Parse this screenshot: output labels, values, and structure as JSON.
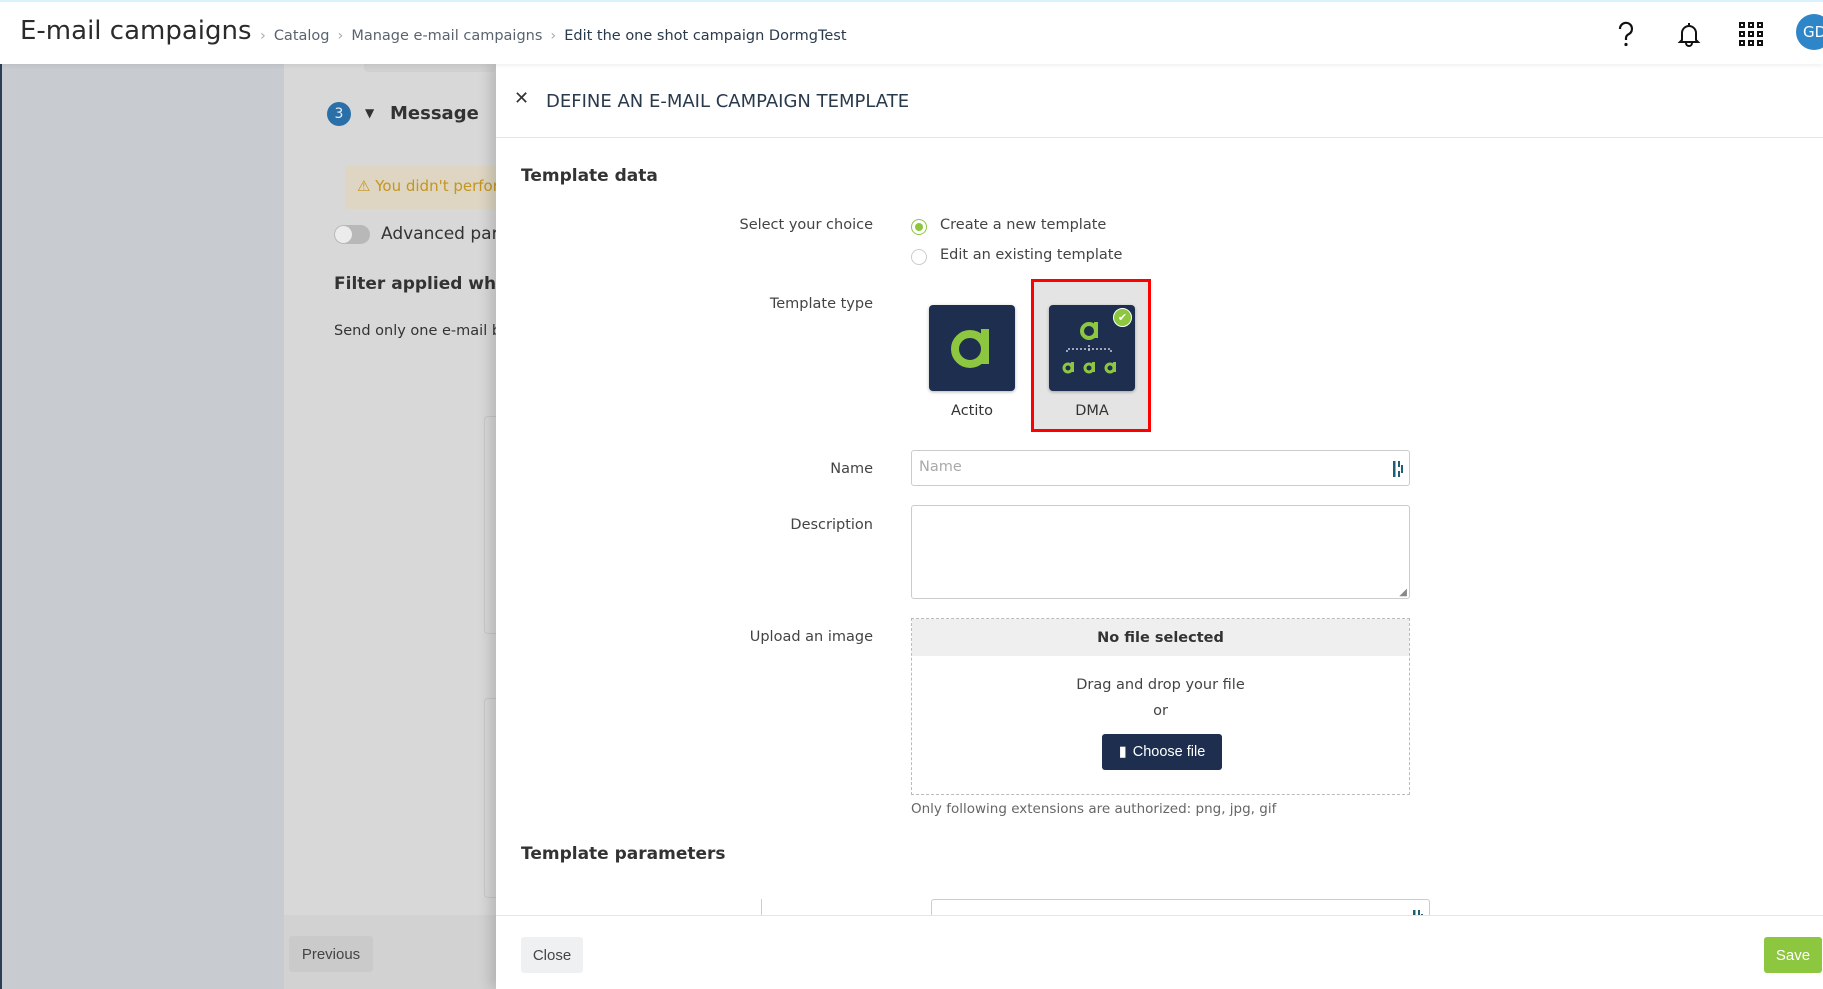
{
  "header": {
    "title": "E-mail campaigns",
    "breadcrumb": [
      "Catalog",
      "Manage e-mail campaigns",
      "Edit the one shot campaign DormgTest"
    ],
    "avatar_initials": "GD",
    "icons": [
      "help-icon",
      "bell-icon",
      "apps-grid-icon"
    ]
  },
  "background": {
    "step_number": "3",
    "step_title": "Message",
    "warning": "You didn't perform",
    "advanced_toggle": "Advanced parameters",
    "filter_heading": "Filter applied when",
    "send_text": "Send only one e-mail by",
    "previous_label": "Previous"
  },
  "panel": {
    "title": "DEFINE AN E-MAIL CAMPAIGN TEMPLATE",
    "template_data": "Template data",
    "select_choice_label": "Select your choice",
    "choices": [
      "Create a new template",
      "Edit an existing template"
    ],
    "selected_choice": "Create a new template",
    "template_type_label": "Template type",
    "template_types": [
      "Actito",
      "DMA"
    ],
    "selected_type": "DMA",
    "name_label": "Name",
    "name_placeholder": "Name",
    "name_value": "",
    "description_label": "Description",
    "description_value": "",
    "upload_label": "Upload an image",
    "upload_status": "No file selected",
    "drag_text": "Drag and drop your file",
    "or_text": "or",
    "choose_file": "Choose file",
    "extensions_note": "Only following extensions are authorized: png, jpg, gif",
    "template_parameters": "Template parameters",
    "close_label": "Close",
    "save_label": "Save"
  },
  "colors": {
    "accent_green": "#8dc63f",
    "navy": "#1d2e4e",
    "highlight_red": "#ff0000",
    "avatar_blue": "#2e86c8"
  }
}
